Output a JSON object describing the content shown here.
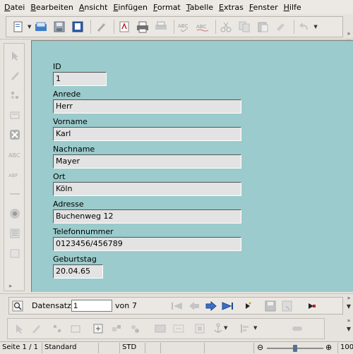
{
  "menu": [
    "Datei",
    "Bearbeiten",
    "Ansicht",
    "Einfügen",
    "Format",
    "Tabelle",
    "Extras",
    "Fenster",
    "Hilfe"
  ],
  "toolbar_icons": [
    "new-document-icon",
    "open-icon",
    "save-icon",
    "edit-mode-icon",
    "pencil-icon",
    "export-pdf-icon",
    "print-icon",
    "print-preview-icon",
    "spellcheck-icon",
    "autospell-icon",
    "cut-icon",
    "copy-icon",
    "paste-icon",
    "format-paintbrush-icon",
    "undo-icon"
  ],
  "form": {
    "fields": [
      {
        "label": "ID",
        "value": "1"
      },
      {
        "label": "Anrede",
        "value": "Herr"
      },
      {
        "label": "Vorname",
        "value": "Karl"
      },
      {
        "label": "Nachname",
        "value": "Mayer"
      },
      {
        "label": "Ort",
        "value": "Köln"
      },
      {
        "label": "Adresse",
        "value": "Buchenweg 12"
      },
      {
        "label": "Telefonnummer",
        "value": "0123456/456789"
      },
      {
        "label": "Geburtstag",
        "value": "20.04.65"
      }
    ],
    "background_color": "#9bcbcc"
  },
  "navigation": {
    "record_label": "Datensatz",
    "record_value": "1",
    "of_label": "von",
    "total": "7"
  },
  "status": {
    "page": "Seite 1 / 1",
    "style": "Standard",
    "mode": "STD",
    "zoom_level": "100",
    "zoom_percent": 0.5
  }
}
